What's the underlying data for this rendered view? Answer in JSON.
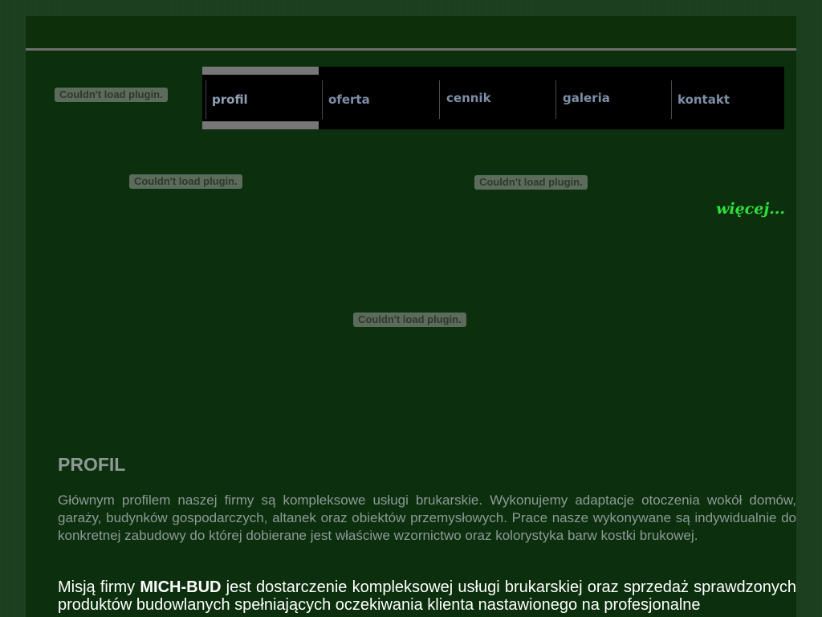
{
  "plugins": {
    "message": "Couldn't load plugin."
  },
  "nav": {
    "items": [
      {
        "label": "profil"
      },
      {
        "label": "oferta"
      },
      {
        "label": "cennik"
      },
      {
        "label": "galeria"
      },
      {
        "label": "kontakt"
      }
    ]
  },
  "more_link": "więcej...",
  "content": {
    "heading": "PROFIL",
    "paragraph1": "Głównym profilem naszej firmy są kompleksowe usługi brukarskie. Wykonujemy adaptacje otoczenia wokół domów, garaży, budynków gospodarczych, altanek oraz obiektów przemysłowych. Prace nasze wykonywane są indywidualnie do konkretnej zabudowy do której dobierane jest właściwe wzornictwo oraz kolorystyka barw kostki brukowej.",
    "paragraph2_before": "Misją firmy ",
    "paragraph2_company": "MICH-BUD",
    "paragraph2_after": " jest dostarczenie kompleksowej usługi brukarskiej oraz sprzedaż sprawdzonych produktów budowlanych spełniających oczekiwania klienta nastawionego na profesjonalne"
  },
  "colors": {
    "outer_background": "#1b3f1e",
    "page_background": "#0c2f0d",
    "nav_background": "#000000",
    "nav_text": "#7d8fa8",
    "nav_active_bar": "#777777",
    "more_link": "#2fe03c",
    "body_text_muted": "#8d9a97",
    "body_text_bright": "#ffffff"
  }
}
